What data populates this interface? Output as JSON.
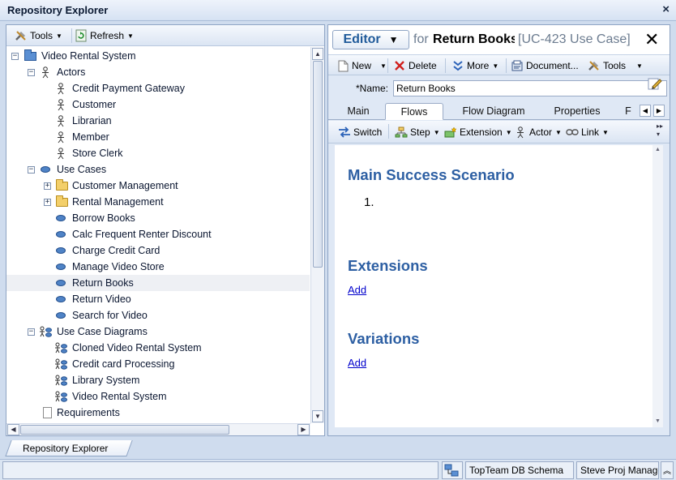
{
  "window": {
    "title": "Repository Explorer",
    "close_icon": "×"
  },
  "left_toolbar": {
    "tools_label": "Tools",
    "refresh_label": "Refresh"
  },
  "tree": {
    "root": "Video Rental System",
    "actors": {
      "label": "Actors",
      "items": [
        "Credit Payment Gateway",
        "Customer",
        "Librarian",
        "Member",
        "Store Clerk"
      ]
    },
    "use_cases": {
      "label": "Use Cases",
      "folders": [
        "Customer Management",
        "Rental Management"
      ],
      "items": [
        "Borrow Books",
        "Calc Frequent Renter Discount",
        "Charge Credit Card",
        "Manage Video Store",
        "Return Books",
        "Return Video",
        "Search for Video"
      ]
    },
    "diagrams": {
      "label": "Use Case Diagrams",
      "items": [
        "Cloned Video Rental System",
        "Credit card Processing",
        "Library System",
        "Video Rental System"
      ]
    },
    "requirements": "Requirements"
  },
  "editor": {
    "mode_label": "Editor",
    "for_label": "for",
    "item_name": "Return Books",
    "item_id": "[UC-423 Use Case]",
    "toolbar": {
      "new": "New",
      "delete": "Delete",
      "more": "More",
      "document": "Document...",
      "tools": "Tools"
    },
    "name_label": "*Name:",
    "name_value": "Return Books",
    "tabs": [
      "Main",
      "Flows",
      "Flow Diagram",
      "Properties",
      "F"
    ],
    "active_tab": "Flows",
    "flow_toolbar": {
      "switch": "Switch",
      "step": "Step",
      "extension": "Extension",
      "actor": "Actor",
      "link": "Link"
    },
    "content": {
      "main_heading": "Main Success Scenario",
      "step_number": "1.",
      "extensions_heading": "Extensions",
      "extensions_add": "Add",
      "variations_heading": "Variations",
      "variations_add": "Add"
    }
  },
  "bottom_tab": "Repository Explorer",
  "status": {
    "schema": "TopTeam DB Schema",
    "project": "Steve Proj Manager"
  },
  "colors": {
    "heading": "#2d5fa3",
    "link": "#0000cc",
    "accent": "#1f5a9a"
  }
}
